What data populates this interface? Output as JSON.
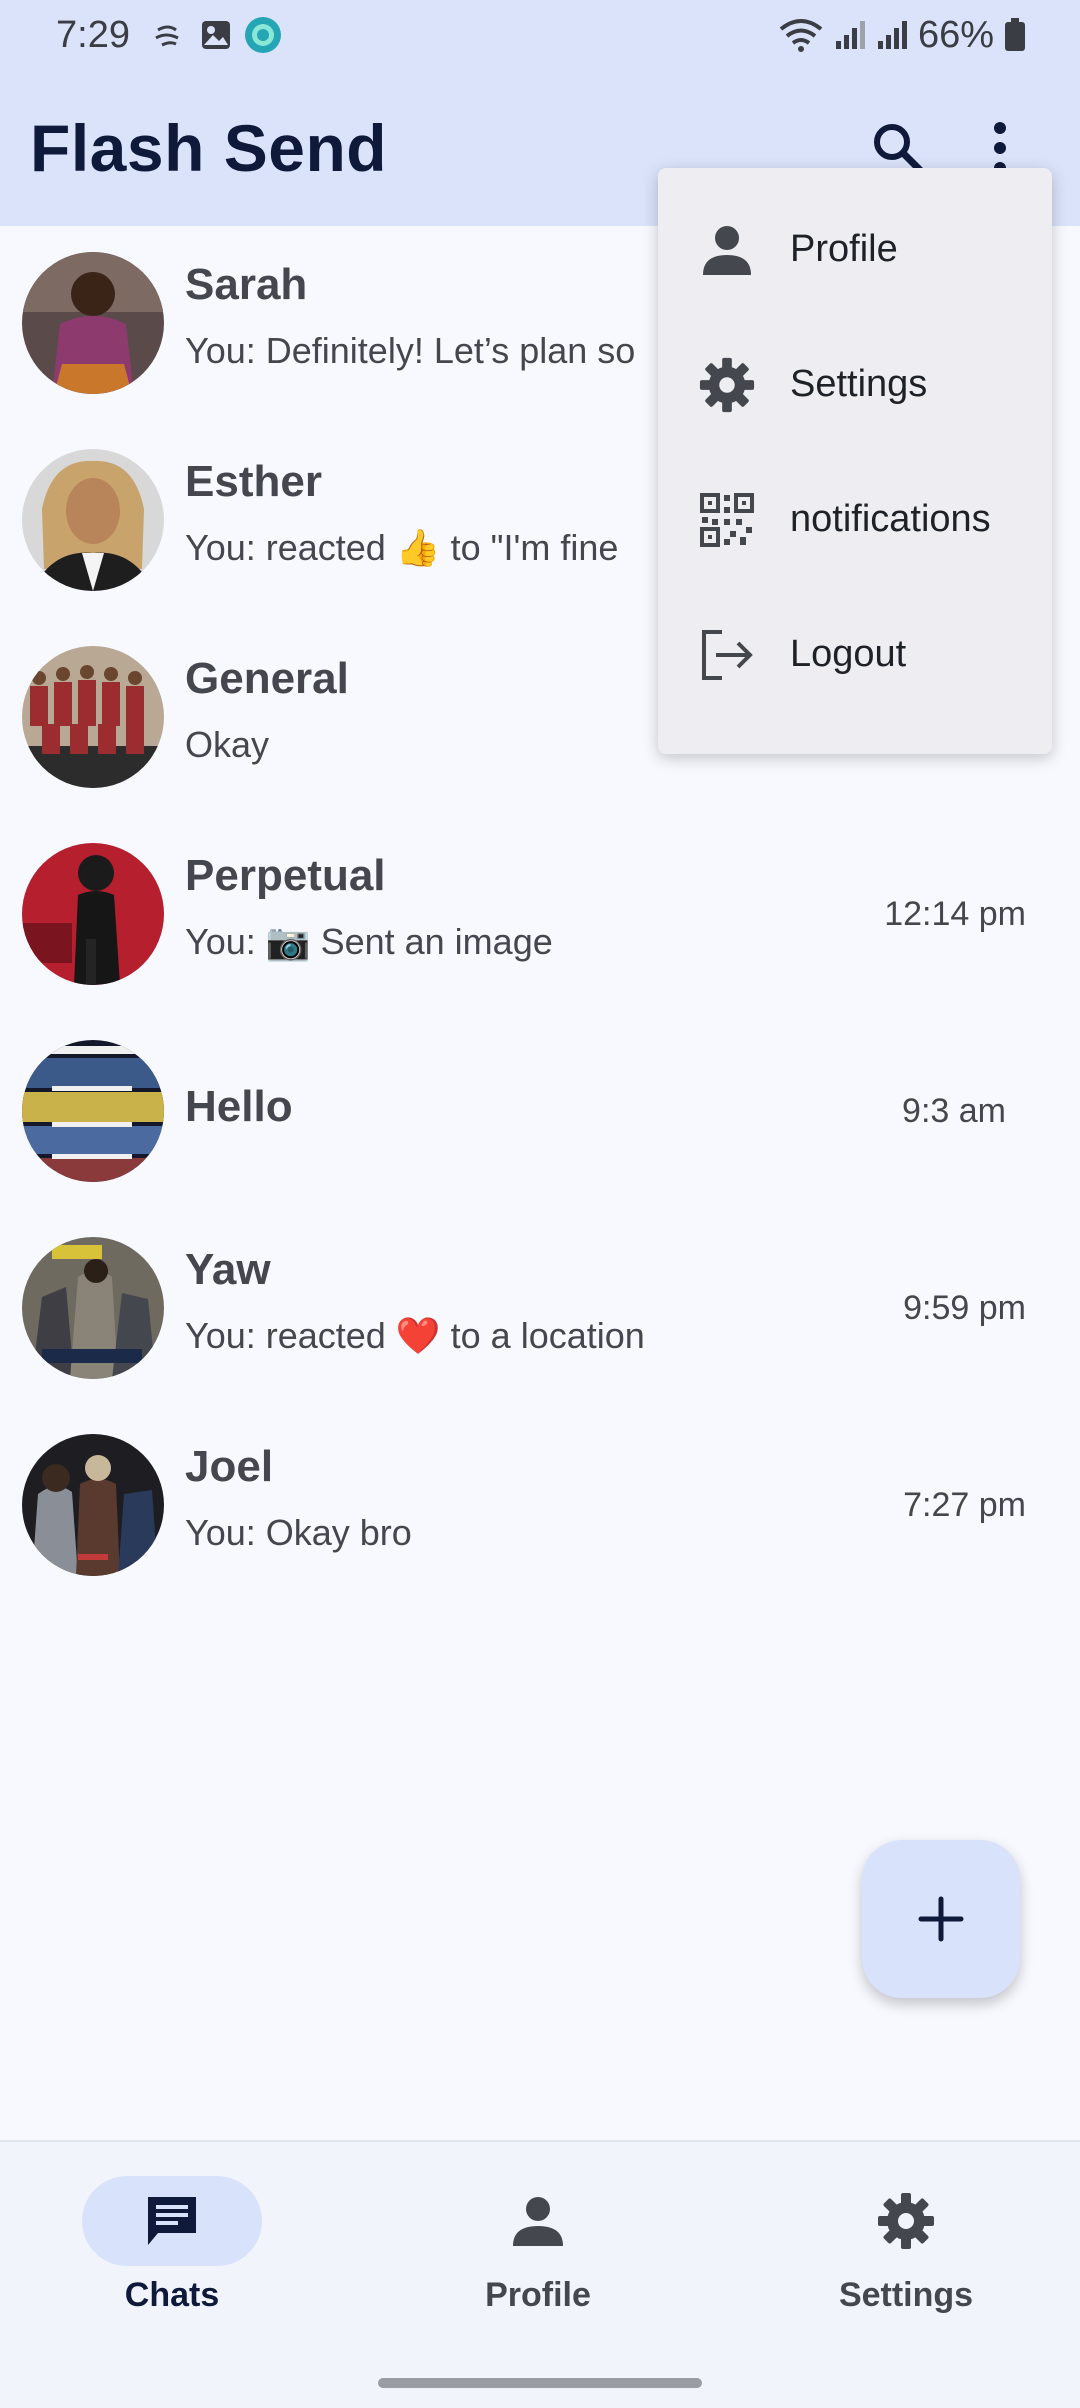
{
  "status_bar": {
    "time": "7:29",
    "battery": "66%"
  },
  "app_bar": {
    "title": "Flash Send"
  },
  "chats": [
    {
      "name": "Sarah",
      "preview": "You: Definitely! Let’s plan so",
      "time": "",
      "avatar_color": "#7a3a62"
    },
    {
      "name": "Esther",
      "preview": "You: reacted 👍 to \"I'm fine",
      "time": "",
      "avatar_color": "#c9a36c"
    },
    {
      "name": "General",
      "preview": "Okay",
      "time": "",
      "avatar_color": "#8a3a3a"
    },
    {
      "name": "Perpetual",
      "preview": "You: 📷 Sent an image",
      "time": "12:14 pm",
      "avatar_color": "#b51f2e"
    },
    {
      "name": "Hello",
      "preview": "",
      "time": "9:3 am",
      "avatar_color": "#3a4a6a"
    },
    {
      "name": "Yaw",
      "preview": "You: reacted ❤️ to a location",
      "time": "9:59 pm",
      "avatar_color": "#5b5a52"
    },
    {
      "name": "Joel",
      "preview": "You: Okay bro",
      "time": "7:27 pm",
      "avatar_color": "#3c3c44"
    }
  ],
  "menu": {
    "items": [
      {
        "label": "Profile",
        "icon": "person-icon"
      },
      {
        "label": "Settings",
        "icon": "gear-icon"
      },
      {
        "label": "notifications",
        "icon": "qr-code-icon"
      },
      {
        "label": "Logout",
        "icon": "logout-icon"
      }
    ]
  },
  "bottom_nav": {
    "items": [
      {
        "label": "Chats",
        "icon": "chat-icon",
        "active": true
      },
      {
        "label": "Profile",
        "icon": "person-icon",
        "active": false
      },
      {
        "label": "Settings",
        "icon": "gear-icon",
        "active": false
      }
    ]
  },
  "colors": {
    "app_bar_bg": "#dbe3fb",
    "accent": "#0f1a3a",
    "fab_bg": "#d8e2fb"
  }
}
